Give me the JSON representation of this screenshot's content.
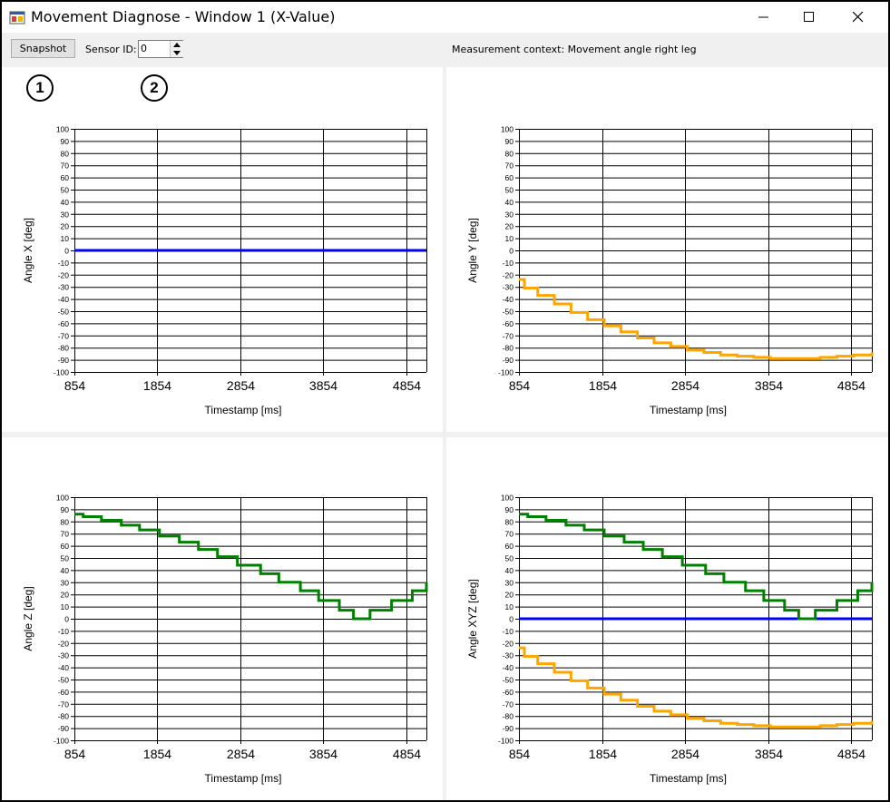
{
  "window": {
    "title": "Movement Diagnose - Window 1 (X-Value)",
    "icon": "app-window-icon",
    "controls": {
      "minimize": "minimize-icon",
      "maximize": "maximize-icon",
      "close": "close-icon"
    }
  },
  "toolbar": {
    "snapshot_label": "Snapshot",
    "sensor_label": "Sensor ID:",
    "sensor_value": "0",
    "context_text": "Measurement context: Movement angle right leg"
  },
  "markers": [
    "1",
    "2"
  ],
  "colors": {
    "x": "#0000ff",
    "y": "#ffa500",
    "z": "#008000"
  },
  "chart_data": [
    {
      "type": "line",
      "ylabel": "Angle X [deg]",
      "xlabel": "Timestamp [ms]",
      "ylim": [
        -100,
        100
      ],
      "xlim": [
        854,
        5100
      ],
      "xticks": [
        854,
        1854,
        2854,
        3854,
        4854
      ],
      "yticks": [
        100,
        90,
        80,
        70,
        60,
        50,
        40,
        30,
        20,
        10,
        0,
        -10,
        -20,
        -30,
        -40,
        -50,
        -60,
        -70,
        -80,
        -90,
        -100
      ],
      "grid": true,
      "series": [
        {
          "color": "#0000ff",
          "x": [
            854,
            5100
          ],
          "y": [
            0,
            0
          ]
        }
      ]
    },
    {
      "type": "line",
      "ylabel": "Angle Y [deg]",
      "xlabel": "Timestamp [ms]",
      "ylim": [
        -100,
        100
      ],
      "xlim": [
        854,
        5100
      ],
      "xticks": [
        854,
        1854,
        2854,
        3854,
        4854
      ],
      "yticks": [
        100,
        90,
        80,
        70,
        60,
        50,
        40,
        30,
        20,
        10,
        0,
        -10,
        -20,
        -30,
        -40,
        -50,
        -60,
        -70,
        -80,
        -90,
        -100
      ],
      "grid": true,
      "series": [
        {
          "color": "#ffa500",
          "x": [
            854,
            920,
            1080,
            1280,
            1480,
            1680,
            1880,
            2080,
            2280,
            2480,
            2680,
            2880,
            3080,
            3280,
            3480,
            3680,
            3880,
            4080,
            4280,
            4480,
            4680,
            4880,
            5100
          ],
          "y": [
            -24,
            -31,
            -37,
            -44,
            -51,
            -57,
            -62,
            -67,
            -72,
            -76,
            -79,
            -82,
            -84,
            -86,
            -87,
            -88,
            -89,
            -89,
            -89,
            -88,
            -87,
            -86,
            -84
          ]
        }
      ]
    },
    {
      "type": "line",
      "ylabel": "Angle Z [deg]",
      "xlabel": "Timestamp [ms]",
      "ylim": [
        -100,
        100
      ],
      "xlim": [
        854,
        5100
      ],
      "xticks": [
        854,
        1854,
        2854,
        3854,
        4854
      ],
      "yticks": [
        100,
        90,
        80,
        70,
        60,
        50,
        40,
        30,
        20,
        10,
        0,
        -10,
        -20,
        -30,
        -40,
        -50,
        -60,
        -70,
        -80,
        -90,
        -100
      ],
      "grid": true,
      "series": [
        {
          "color": "#008000",
          "x": [
            854,
            960,
            1180,
            1420,
            1640,
            1880,
            2120,
            2350,
            2580,
            2820,
            3100,
            3320,
            3580,
            3800,
            4050,
            4220,
            4420,
            4680,
            4930,
            5100
          ],
          "y": [
            86,
            84,
            81,
            77,
            73,
            68,
            63,
            57,
            51,
            44,
            37,
            30,
            23,
            15,
            7,
            0,
            7,
            15,
            23,
            30
          ]
        }
      ]
    },
    {
      "type": "line",
      "ylabel": "Angle XYZ [deg]",
      "xlabel": "Timestamp [ms]",
      "ylim": [
        -100,
        100
      ],
      "xlim": [
        854,
        5100
      ],
      "xticks": [
        854,
        1854,
        2854,
        3854,
        4854
      ],
      "yticks": [
        100,
        90,
        80,
        70,
        60,
        50,
        40,
        30,
        20,
        10,
        0,
        -10,
        -20,
        -30,
        -40,
        -50,
        -60,
        -70,
        -80,
        -90,
        -100
      ],
      "grid": true,
      "series": [
        {
          "color": "#0000ff",
          "x": [
            854,
            5100
          ],
          "y": [
            0,
            0
          ]
        },
        {
          "color": "#ffa500",
          "x": [
            854,
            920,
            1080,
            1280,
            1480,
            1680,
            1880,
            2080,
            2280,
            2480,
            2680,
            2880,
            3080,
            3280,
            3480,
            3680,
            3880,
            4080,
            4280,
            4480,
            4680,
            4880,
            5100
          ],
          "y": [
            -24,
            -31,
            -37,
            -44,
            -51,
            -57,
            -62,
            -67,
            -72,
            -76,
            -79,
            -82,
            -84,
            -86,
            -87,
            -88,
            -89,
            -89,
            -89,
            -88,
            -87,
            -86,
            -84
          ]
        },
        {
          "color": "#008000",
          "x": [
            854,
            960,
            1180,
            1420,
            1640,
            1880,
            2120,
            2350,
            2580,
            2820,
            3100,
            3320,
            3580,
            3800,
            4050,
            4220,
            4420,
            4680,
            4930,
            5100
          ],
          "y": [
            86,
            84,
            81,
            77,
            73,
            68,
            63,
            57,
            51,
            44,
            37,
            30,
            23,
            15,
            7,
            0,
            7,
            15,
            23,
            30
          ]
        }
      ]
    }
  ]
}
